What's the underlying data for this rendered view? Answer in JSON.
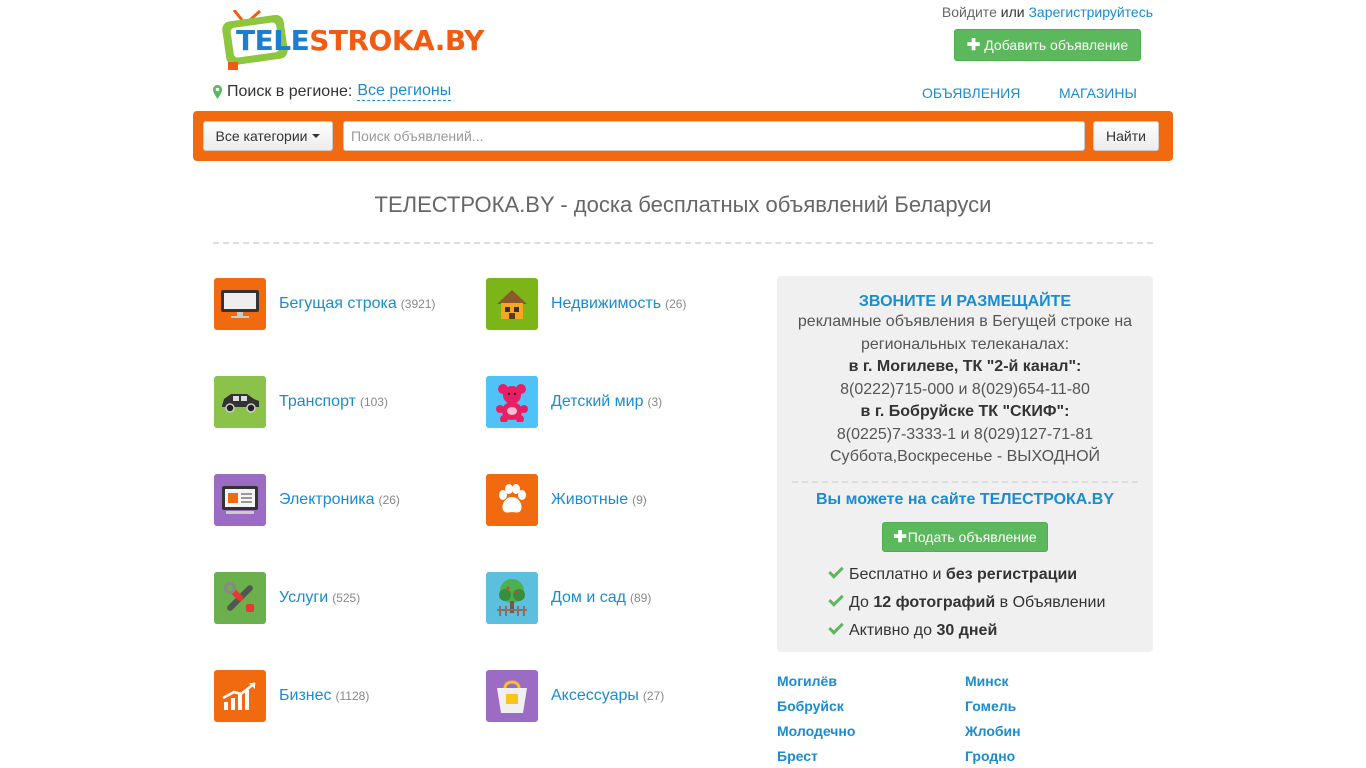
{
  "header": {
    "logo": {
      "part1": "TELE",
      "part2": "STROKA.BY"
    },
    "login_label": "Войдите",
    "or_label": "или",
    "register_label": "Зарегистрируйтесь",
    "add_button_label": "Добавить объявление",
    "region_label": "Поиск в регионе:",
    "region_value": "Все регионы",
    "nav": [
      "ОБЪЯВЛЕНИЯ",
      "МАГАЗИНЫ"
    ]
  },
  "search": {
    "category_label": "Все категории",
    "placeholder": "Поиск объявлений...",
    "submit_label": "Найти"
  },
  "tagline": "ТЕЛЕСТРОКА.BY - доска бесплатных объявлений Беларуси",
  "categories": [
    {
      "name": "Бегущая строка",
      "count": "(3921)",
      "icon": "tv-monitor-icon",
      "color": "#f26a10"
    },
    {
      "name": "Недвижимость",
      "count": "(26)",
      "icon": "house-icon",
      "color": "#7cb518"
    },
    {
      "name": "Транспорт",
      "count": "(103)",
      "icon": "car-icon",
      "color": "#8bc34a"
    },
    {
      "name": "Детский мир",
      "count": "(3)",
      "icon": "teddy-bear-icon",
      "color": "#4fc3f7"
    },
    {
      "name": "Электроника",
      "count": "(26)",
      "icon": "electronics-icon",
      "color": "#9c6bc3"
    },
    {
      "name": "Животные",
      "count": "(9)",
      "icon": "paw-icon",
      "color": "#f26a10"
    },
    {
      "name": "Услуги",
      "count": "(525)",
      "icon": "tools-icon",
      "color": "#6ab04c"
    },
    {
      "name": "Дом и сад",
      "count": "(89)",
      "icon": "tree-icon",
      "color": "#5bc0de"
    },
    {
      "name": "Бизнес",
      "count": "(1128)",
      "icon": "chart-up-icon",
      "color": "#f26a10"
    },
    {
      "name": "Аксессуары",
      "count": "(27)",
      "icon": "shopping-bag-icon",
      "color": "#9c6bc3"
    }
  ],
  "promo": {
    "title": "ЗВОНИТЕ И РАЗМЕЩАЙТЕ",
    "line1": "рекламные объявления в Бегущей строке на региональных телеканалах:",
    "mogilev_label": "в г. Могилеве, ТК \"2-й канал\":",
    "mogilev_phones": "8(0222)715-000 и 8(029)654-11-80",
    "bobruisk_label": "в г. Бобруйске ТК \"СКИФ\":",
    "bobruisk_phones": "8(0225)7-3333-1 и 8(029)127-71-81",
    "weekend": "Суббота,Воскресенье - ВЫХОДНОЙ",
    "subtitle": "Вы можете на сайте ТЕЛЕСТРОКА.BY",
    "button_label": "Подать объявление",
    "features": [
      {
        "pre": "Бесплатно и ",
        "bold": "без регистрации",
        "post": ""
      },
      {
        "pre": "До ",
        "bold": "12 фотографий",
        "post": " в Объявлении"
      },
      {
        "pre": "Активно до ",
        "bold": "30 дней",
        "post": ""
      }
    ]
  },
  "cities": [
    "Могилёв",
    "Минск",
    "Бобруйск",
    "Гомель",
    "Молодечно",
    "Жлобин",
    "Брест",
    "Гродно"
  ]
}
